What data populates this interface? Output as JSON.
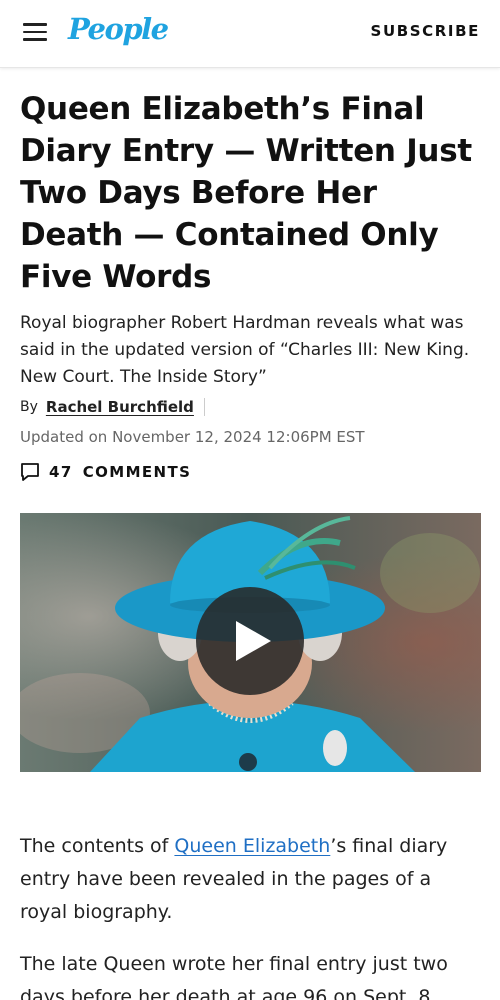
{
  "header": {
    "logo_text": "People",
    "subscribe_label": "SUBSCRIBE",
    "icons": {
      "menu": "hamburger-menu-icon",
      "comments": "speech-bubble-icon",
      "play": "play-icon"
    },
    "colors": {
      "logo": "#1fa3e0",
      "link": "#1f6fc4"
    }
  },
  "article": {
    "headline": "Queen Elizabeth’s Final Diary Entry — Written Just Two Days Before Her Death — Contained Only Five Words",
    "dek": "Royal biographer Robert Hardman reveals what was said in the updated version of “Charles III: New King. New Court. The Inside Story”",
    "by_label": "By",
    "author": "Rachel Burchfield",
    "updated": "Updated on November 12, 2024 12:06PM EST",
    "comments_count": "47",
    "comments_label": "COMMENTS"
  },
  "body": {
    "p1_before": "The contents of ",
    "p1_link": "Queen Elizabeth",
    "p1_after": "’s final diary entry have been revealed in the pages of a royal biography.",
    "p2": "The late Queen wrote her final entry just two days before her death at age 96 on Sept. 8"
  }
}
